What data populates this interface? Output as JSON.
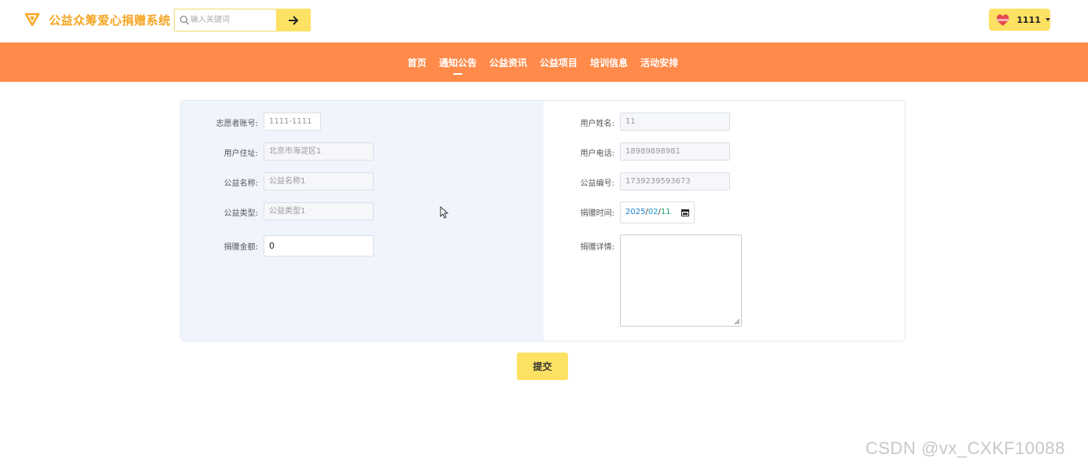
{
  "header": {
    "app_title": "公益众筹爱心捐赠系统",
    "search": {
      "placeholder": "输入关键词",
      "value": ""
    },
    "user": {
      "name": "1111"
    }
  },
  "nav": {
    "items": [
      {
        "label": "首页",
        "active": false
      },
      {
        "label": "通知公告",
        "active": true
      },
      {
        "label": "公益资讯",
        "active": false
      },
      {
        "label": "公益项目",
        "active": false
      },
      {
        "label": "培训信息",
        "active": false
      },
      {
        "label": "活动安排",
        "active": false
      }
    ]
  },
  "form": {
    "left": {
      "volunteer_account": {
        "label": "志愿者账号:",
        "value": "1111-1111"
      },
      "user_address": {
        "label": "用户住址:",
        "value": "北京市海淀区1"
      },
      "charity_name": {
        "label": "公益名称:",
        "value": "公益名称1"
      },
      "charity_type": {
        "label": "公益类型:",
        "value": "公益类型1"
      },
      "donation_amount": {
        "label": "捐赠金额:",
        "value": "0"
      }
    },
    "right": {
      "user_name": {
        "label": "用户姓名:",
        "value": "11"
      },
      "user_phone": {
        "label": "用户电话:",
        "value": "18989898981"
      },
      "charity_code": {
        "label": "公益编号:",
        "value": "1739239593673"
      },
      "donation_time": {
        "label": "捐赠时间:",
        "year": "2025",
        "month": "02",
        "day": "11",
        "sep": "/"
      },
      "donation_details": {
        "label": "捐赠详情:",
        "value": ""
      }
    },
    "submit_label": "提交"
  },
  "watermark": "CSDN @vx_CXKF10088",
  "colors": {
    "accent_orange": "#ff8a4a",
    "accent_yellow": "#fde163",
    "title_orange": "#f5a623",
    "panel_blue": "#f0f5fd"
  }
}
